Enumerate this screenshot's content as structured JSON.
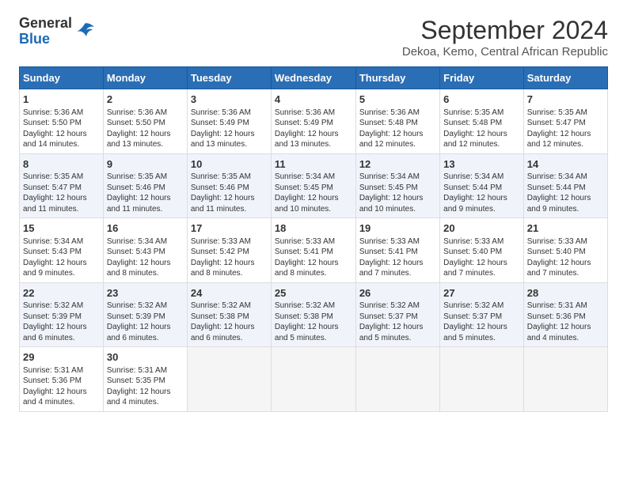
{
  "logo": {
    "text_general": "General",
    "text_blue": "Blue"
  },
  "title": "September 2024",
  "subtitle": "Dekoa, Kemo, Central African Republic",
  "headers": [
    "Sunday",
    "Monday",
    "Tuesday",
    "Wednesday",
    "Thursday",
    "Friday",
    "Saturday"
  ],
  "weeks": [
    [
      {
        "day": "1",
        "sunrise": "Sunrise: 5:36 AM",
        "sunset": "Sunset: 5:50 PM",
        "daylight": "Daylight: 12 hours and 14 minutes."
      },
      {
        "day": "2",
        "sunrise": "Sunrise: 5:36 AM",
        "sunset": "Sunset: 5:50 PM",
        "daylight": "Daylight: 12 hours and 13 minutes."
      },
      {
        "day": "3",
        "sunrise": "Sunrise: 5:36 AM",
        "sunset": "Sunset: 5:49 PM",
        "daylight": "Daylight: 12 hours and 13 minutes."
      },
      {
        "day": "4",
        "sunrise": "Sunrise: 5:36 AM",
        "sunset": "Sunset: 5:49 PM",
        "daylight": "Daylight: 12 hours and 13 minutes."
      },
      {
        "day": "5",
        "sunrise": "Sunrise: 5:36 AM",
        "sunset": "Sunset: 5:48 PM",
        "daylight": "Daylight: 12 hours and 12 minutes."
      },
      {
        "day": "6",
        "sunrise": "Sunrise: 5:35 AM",
        "sunset": "Sunset: 5:48 PM",
        "daylight": "Daylight: 12 hours and 12 minutes."
      },
      {
        "day": "7",
        "sunrise": "Sunrise: 5:35 AM",
        "sunset": "Sunset: 5:47 PM",
        "daylight": "Daylight: 12 hours and 12 minutes."
      }
    ],
    [
      {
        "day": "8",
        "sunrise": "Sunrise: 5:35 AM",
        "sunset": "Sunset: 5:47 PM",
        "daylight": "Daylight: 12 hours and 11 minutes."
      },
      {
        "day": "9",
        "sunrise": "Sunrise: 5:35 AM",
        "sunset": "Sunset: 5:46 PM",
        "daylight": "Daylight: 12 hours and 11 minutes."
      },
      {
        "day": "10",
        "sunrise": "Sunrise: 5:35 AM",
        "sunset": "Sunset: 5:46 PM",
        "daylight": "Daylight: 12 hours and 11 minutes."
      },
      {
        "day": "11",
        "sunrise": "Sunrise: 5:34 AM",
        "sunset": "Sunset: 5:45 PM",
        "daylight": "Daylight: 12 hours and 10 minutes."
      },
      {
        "day": "12",
        "sunrise": "Sunrise: 5:34 AM",
        "sunset": "Sunset: 5:45 PM",
        "daylight": "Daylight: 12 hours and 10 minutes."
      },
      {
        "day": "13",
        "sunrise": "Sunrise: 5:34 AM",
        "sunset": "Sunset: 5:44 PM",
        "daylight": "Daylight: 12 hours and 9 minutes."
      },
      {
        "day": "14",
        "sunrise": "Sunrise: 5:34 AM",
        "sunset": "Sunset: 5:44 PM",
        "daylight": "Daylight: 12 hours and 9 minutes."
      }
    ],
    [
      {
        "day": "15",
        "sunrise": "Sunrise: 5:34 AM",
        "sunset": "Sunset: 5:43 PM",
        "daylight": "Daylight: 12 hours and 9 minutes."
      },
      {
        "day": "16",
        "sunrise": "Sunrise: 5:34 AM",
        "sunset": "Sunset: 5:43 PM",
        "daylight": "Daylight: 12 hours and 8 minutes."
      },
      {
        "day": "17",
        "sunrise": "Sunrise: 5:33 AM",
        "sunset": "Sunset: 5:42 PM",
        "daylight": "Daylight: 12 hours and 8 minutes."
      },
      {
        "day": "18",
        "sunrise": "Sunrise: 5:33 AM",
        "sunset": "Sunset: 5:41 PM",
        "daylight": "Daylight: 12 hours and 8 minutes."
      },
      {
        "day": "19",
        "sunrise": "Sunrise: 5:33 AM",
        "sunset": "Sunset: 5:41 PM",
        "daylight": "Daylight: 12 hours and 7 minutes."
      },
      {
        "day": "20",
        "sunrise": "Sunrise: 5:33 AM",
        "sunset": "Sunset: 5:40 PM",
        "daylight": "Daylight: 12 hours and 7 minutes."
      },
      {
        "day": "21",
        "sunrise": "Sunrise: 5:33 AM",
        "sunset": "Sunset: 5:40 PM",
        "daylight": "Daylight: 12 hours and 7 minutes."
      }
    ],
    [
      {
        "day": "22",
        "sunrise": "Sunrise: 5:32 AM",
        "sunset": "Sunset: 5:39 PM",
        "daylight": "Daylight: 12 hours and 6 minutes."
      },
      {
        "day": "23",
        "sunrise": "Sunrise: 5:32 AM",
        "sunset": "Sunset: 5:39 PM",
        "daylight": "Daylight: 12 hours and 6 minutes."
      },
      {
        "day": "24",
        "sunrise": "Sunrise: 5:32 AM",
        "sunset": "Sunset: 5:38 PM",
        "daylight": "Daylight: 12 hours and 6 minutes."
      },
      {
        "day": "25",
        "sunrise": "Sunrise: 5:32 AM",
        "sunset": "Sunset: 5:38 PM",
        "daylight": "Daylight: 12 hours and 5 minutes."
      },
      {
        "day": "26",
        "sunrise": "Sunrise: 5:32 AM",
        "sunset": "Sunset: 5:37 PM",
        "daylight": "Daylight: 12 hours and 5 minutes."
      },
      {
        "day": "27",
        "sunrise": "Sunrise: 5:32 AM",
        "sunset": "Sunset: 5:37 PM",
        "daylight": "Daylight: 12 hours and 5 minutes."
      },
      {
        "day": "28",
        "sunrise": "Sunrise: 5:31 AM",
        "sunset": "Sunset: 5:36 PM",
        "daylight": "Daylight: 12 hours and 4 minutes."
      }
    ],
    [
      {
        "day": "29",
        "sunrise": "Sunrise: 5:31 AM",
        "sunset": "Sunset: 5:36 PM",
        "daylight": "Daylight: 12 hours and 4 minutes."
      },
      {
        "day": "30",
        "sunrise": "Sunrise: 5:31 AM",
        "sunset": "Sunset: 5:35 PM",
        "daylight": "Daylight: 12 hours and 4 minutes."
      },
      null,
      null,
      null,
      null,
      null
    ]
  ]
}
